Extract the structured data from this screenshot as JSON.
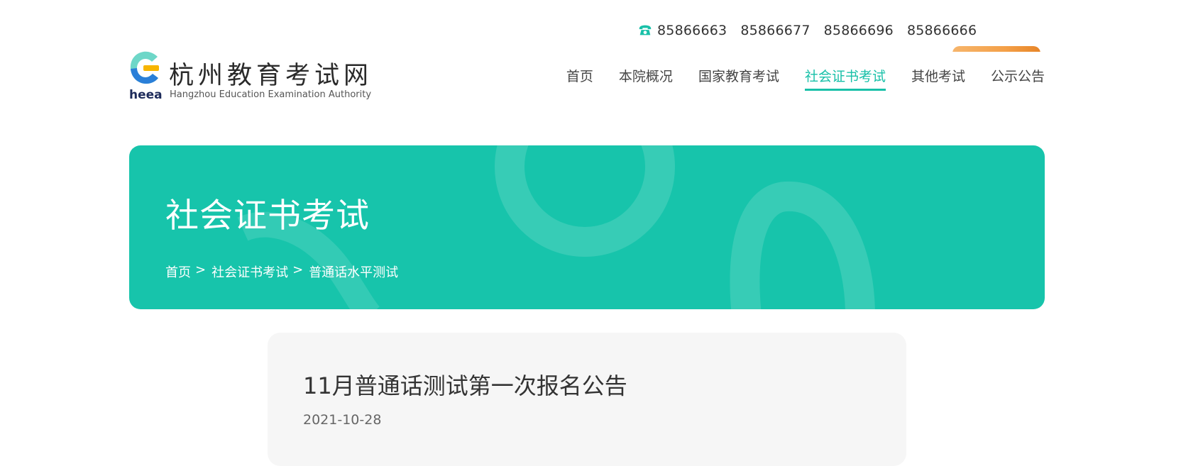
{
  "header": {
    "phones": [
      "85866663",
      "85866677",
      "85866696",
      "85866666"
    ],
    "logo": {
      "heea": "heea",
      "name_cn": "杭州教育考试网",
      "name_en": "Hangzhou Education Examination Authority"
    },
    "nav": [
      {
        "label": "首页"
      },
      {
        "label": "本院概况"
      },
      {
        "label": "国家教育考试"
      },
      {
        "label": "社会证书考试",
        "active": true
      },
      {
        "label": "其他考试"
      },
      {
        "label": "公示公告"
      }
    ]
  },
  "banner": {
    "title": "社会证书考试",
    "breadcrumb": [
      {
        "label": "首页"
      },
      {
        "label": "社会证书考试"
      },
      {
        "label": "普通话水平测试"
      }
    ],
    "separator": ">"
  },
  "article": {
    "title": "11月普通话测试第一次报名公告",
    "date": "2021-10-28"
  },
  "colors": {
    "accent": "#18c0a8",
    "banner": "#17c4ab",
    "tab_orange": "#f4a048"
  },
  "icons": {
    "phone": "phone-icon"
  }
}
